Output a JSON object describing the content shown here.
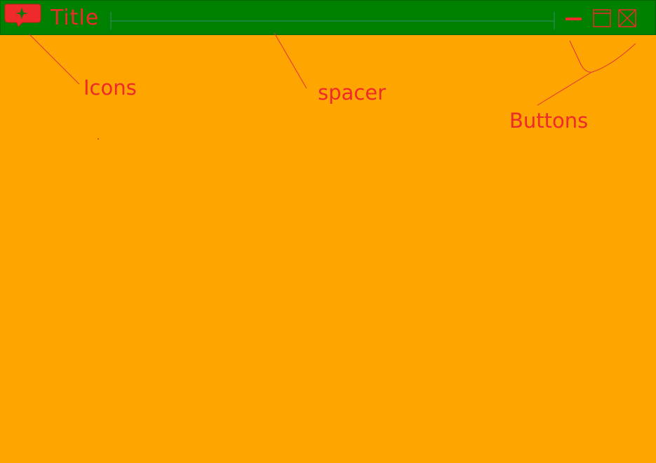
{
  "window": {
    "title": "Title"
  },
  "annotations": {
    "icons": "Icons",
    "spacer": "spacer",
    "buttons": "Buttons"
  },
  "icons": {
    "app": "speech-bubble-star-icon",
    "minimize": "minimize-icon",
    "maximize": "maximize-icon",
    "close": "close-icon"
  },
  "colors": {
    "background": "#FFA500",
    "titlebar": "#008000",
    "accent": "#EE2A2A"
  }
}
